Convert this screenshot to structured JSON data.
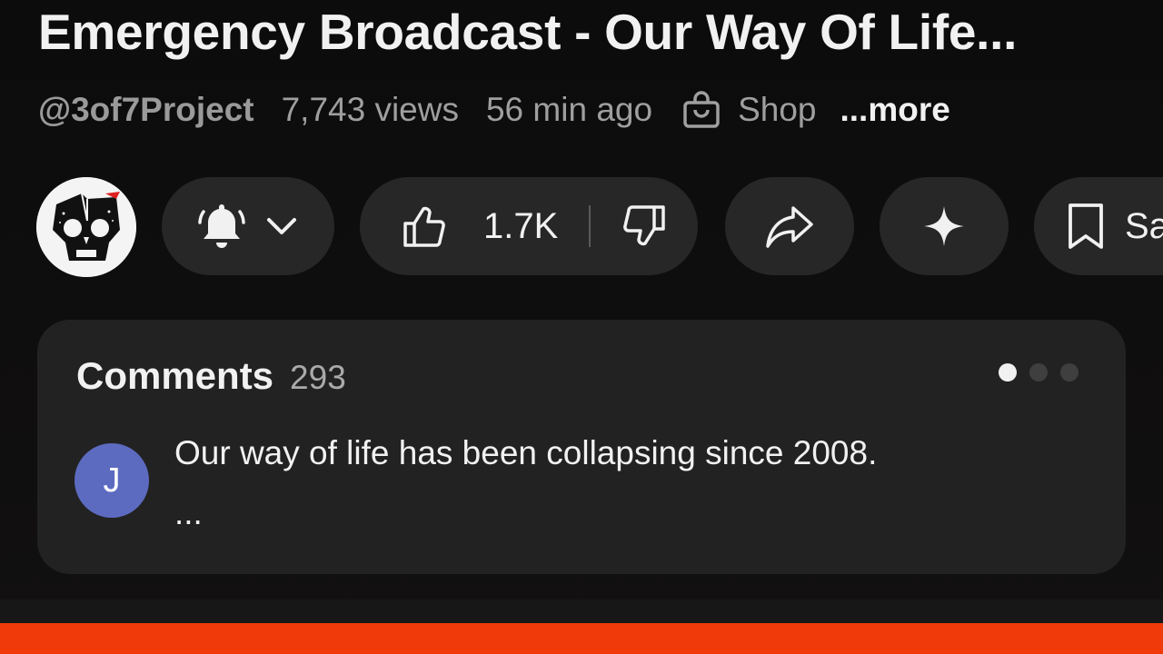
{
  "video": {
    "title": "Emergency Broadcast - Our Way Of Life..."
  },
  "meta": {
    "channel": "@3of7Project",
    "views": "7,743 views",
    "time_ago": "56 min ago",
    "shop_label": "Shop",
    "more_label": "...more"
  },
  "actions": {
    "like_count": "1.7K",
    "save_label": "Save"
  },
  "comments": {
    "title": "Comments",
    "count": "293",
    "pager_dots": 3,
    "active_dot": 0,
    "top_comment": {
      "avatar_initial": "J",
      "avatar_color": "#5c6bc0",
      "text": "Our way of life has been collapsing since 2008.",
      "continuation": "..."
    }
  },
  "colors": {
    "background": "#0f0f0f",
    "pill": "#272727",
    "card": "#222222",
    "accent_bar": "#f03a0a"
  },
  "icons": {
    "channel_avatar": "skull-logo-icon",
    "bell": "bell-icon",
    "chevron": "chevron-down-icon",
    "like": "thumbs-up-icon",
    "dislike": "thumbs-down-icon",
    "share": "share-icon",
    "sparkle": "sparkle-icon",
    "save": "bookmark-icon",
    "shop": "shopping-bag-icon"
  }
}
